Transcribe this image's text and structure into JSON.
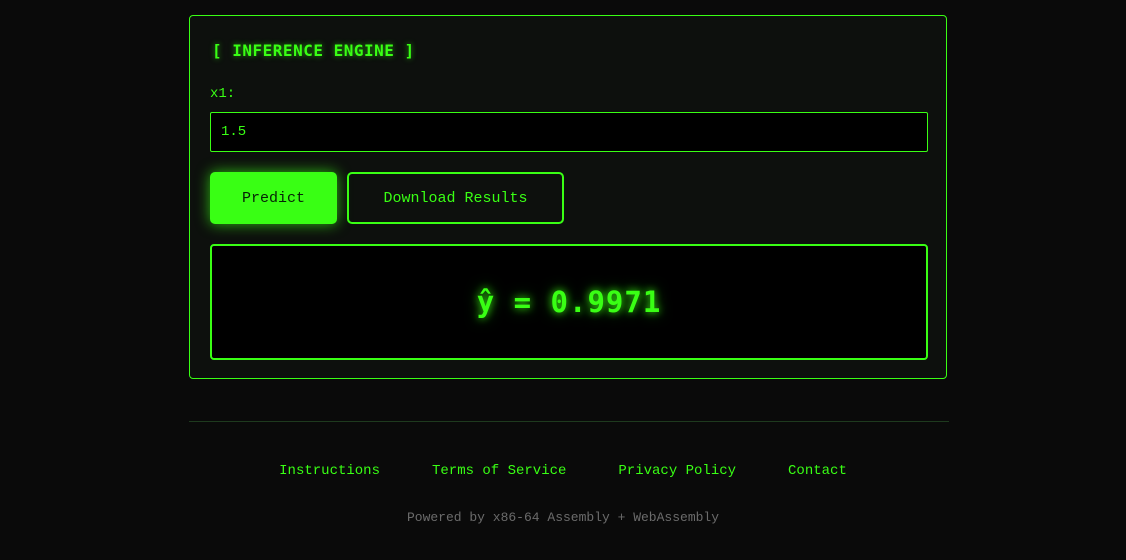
{
  "panel": {
    "title": "[ INFERENCE ENGINE ]",
    "input_label": "x1:",
    "input_value": "1.5"
  },
  "buttons": {
    "predict": "Predict",
    "download": "Download Results"
  },
  "result": {
    "text": "ŷ = 0.9971"
  },
  "footer": {
    "links": [
      "Instructions",
      "Terms of Service",
      "Privacy Policy",
      "Contact"
    ],
    "powered_by": "Powered by x86-64 Assembly + WebAssembly"
  },
  "colors": {
    "accent": "#39ff14",
    "background": "#0a0a0a",
    "muted_text": "#6b6b6b"
  }
}
